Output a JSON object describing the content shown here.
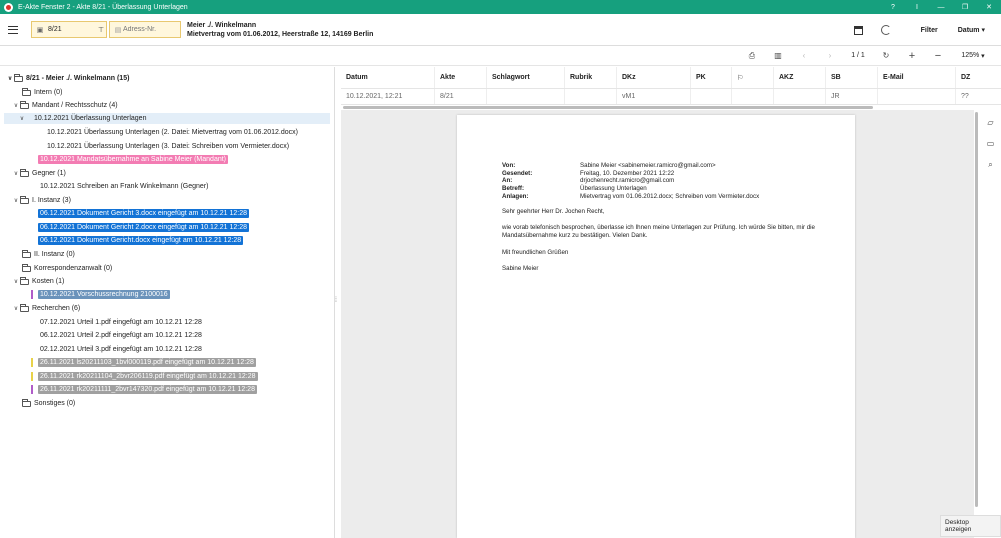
{
  "window": {
    "title": "E-Akte Fenster 2 - Akte 8/21 - Überlassung Unterlagen",
    "buttons": [
      "?",
      "I",
      "—",
      "❐",
      "✕"
    ]
  },
  "header": {
    "akte_value": "8/21",
    "adress_placeholder": "Adress-Nr.",
    "case_line1": "Meier ./. Winkelmann",
    "case_line2": "Mietvertrag vom 01.06.2012, Heerstraße 12, 14169 Berlin",
    "filter_label": "Filter",
    "sort_label": "Datum"
  },
  "toolbar2": {
    "page_indicator": "1 / 1",
    "zoom": "125%"
  },
  "tree": {
    "root": "8/21 - Meier ./. Winkelmann (15)",
    "items": [
      {
        "label": "Intern (0)"
      },
      {
        "label": "Mandant / Rechtsschutz (4)"
      },
      {
        "label": "10.12.2021 Überlassung Unterlagen"
      },
      {
        "label": "10.12.2021 Überlassung Unterlagen (2. Datei: Mietvertrag vom 01.06.2012.docx)"
      },
      {
        "label": "10.12.2021 Überlassung Unterlagen (3. Datei: Schreiben vom Vermieter.docx)"
      },
      {
        "label": "10.12.2021 Mandatsübernahme an Sabine Meier (Mandant)"
      },
      {
        "label": "Gegner (1)"
      },
      {
        "label": "10.12.2021 Schreiben an Frank Winkelmann (Gegner)"
      },
      {
        "label": "I. Instanz (3)"
      },
      {
        "label": "06.12.2021 Dokument Gericht 3.docx eingefügt am 10.12.21 12:28"
      },
      {
        "label": "06.12.2021 Dokument Gericht 2.docx eingefügt am 10.12.21 12:28"
      },
      {
        "label": "06.12.2021 Dokument Gericht.docx eingefügt am 10.12.21 12:28"
      },
      {
        "label": "II. Instanz (0)"
      },
      {
        "label": "Korrespondenzanwalt (0)"
      },
      {
        "label": "Kosten (1)"
      },
      {
        "label": "10.12.2021 Vorschussrechnung 2100016"
      },
      {
        "label": "Recherchen (6)"
      },
      {
        "label": "07.12.2021 Urteil 1.pdf eingefügt am 10.12.21 12:28"
      },
      {
        "label": "06.12.2021 Urteil 2.pdf eingefügt am 10.12.21 12:28"
      },
      {
        "label": "02.12.2021 Urteil 3.pdf eingefügt am 10.12.21 12:28"
      },
      {
        "label": "26.11.2021 ls20211103_1bvl000119.pdf eingefügt am 10.12.21 12:28"
      },
      {
        "label": "26.11.2021 rk20211104_2bvr206119.pdf eingefügt am 10.12.21 12:28"
      },
      {
        "label": "26.11.2021 rk20211111_2bvr147320.pdf eingefügt am 10.12.21 12:28"
      },
      {
        "label": "Sonstiges (0)"
      }
    ]
  },
  "grid": {
    "columns": [
      "Datum",
      "Akte",
      "Schlagwort",
      "Rubrik",
      "DKz",
      "PK",
      "",
      "AKZ",
      "SB",
      "E-Mail",
      "DZ"
    ],
    "row": [
      "10.12.2021, 12:21",
      "8/21",
      "",
      "",
      "vM1",
      "",
      "",
      "",
      "JR",
      "",
      "??"
    ]
  },
  "document": {
    "headers": [
      {
        "k": "Von:",
        "v": "Sabine Meier <sabinemeier.ramicro@gmail.com>"
      },
      {
        "k": "Gesendet:",
        "v": "Freitag, 10. Dezember 2021 12:22"
      },
      {
        "k": "An:",
        "v": "drjochenrecht.ramicro@gmail.com"
      },
      {
        "k": "Betreff:",
        "v": "Überlassung Unterlagen"
      },
      {
        "k": "Anlagen:",
        "v": "Mietvertrag vom 01.06.2012.docx; Schreiben vom Vermieter.docx"
      }
    ],
    "greeting": "Sehr geehrter Herr Dr. Jochen Recht,",
    "body": "wie vorab telefonisch besprochen, überlasse ich Ihnen meine Unterlagen zur Prüfung. Ich würde Sie bitten, mir die Mandatsübernahme kurz zu bestätigen. Vielen Dank.",
    "closing": "Mit freundlichen Grüßen",
    "signature": "Sabine Meier"
  },
  "tooltip": "Desktop anzeigen",
  "colors": {
    "titlebar": "#16a07e",
    "pink": "#f37cb3",
    "blue": "#1373d6",
    "steel": "#6b93bb",
    "gray": "#a0a0a0"
  }
}
